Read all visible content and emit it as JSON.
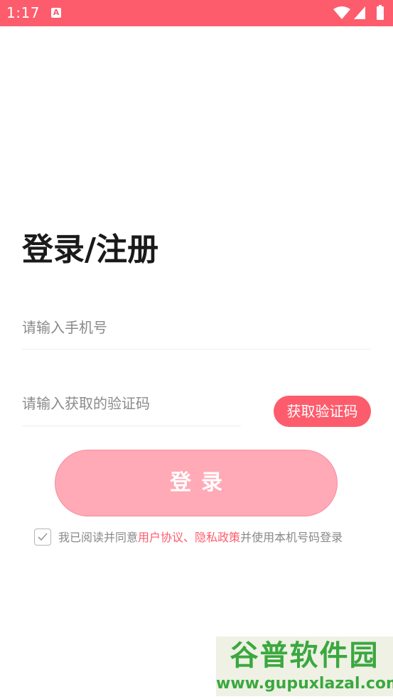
{
  "status_bar": {
    "time": "1:17",
    "app_icon_letter": "A",
    "background_color": "#fd5c6c",
    "icons": [
      "wifi-icon",
      "signal-icon",
      "battery-icon"
    ]
  },
  "page": {
    "title": "登录/注册"
  },
  "form": {
    "phone": {
      "value": "",
      "placeholder": "请输入手机号"
    },
    "code": {
      "value": "",
      "placeholder": "请输入获取的验证码"
    },
    "get_code_label": "获取验证码",
    "login_label": "登录"
  },
  "agreement": {
    "checked": true,
    "prefix": "我已阅读并同意",
    "user_agreement": "用户协议",
    "separator": "、",
    "privacy_policy": "隐私政策",
    "suffix": "并使用本机号码登录"
  },
  "watermark": {
    "title": "谷普软件园",
    "url": "www.gupuxlazal.com"
  },
  "colors": {
    "accent": "#fd5c6c",
    "login_button": "#ffaab6",
    "title_text": "#1a1a1a",
    "placeholder": "#8a8a8a"
  }
}
